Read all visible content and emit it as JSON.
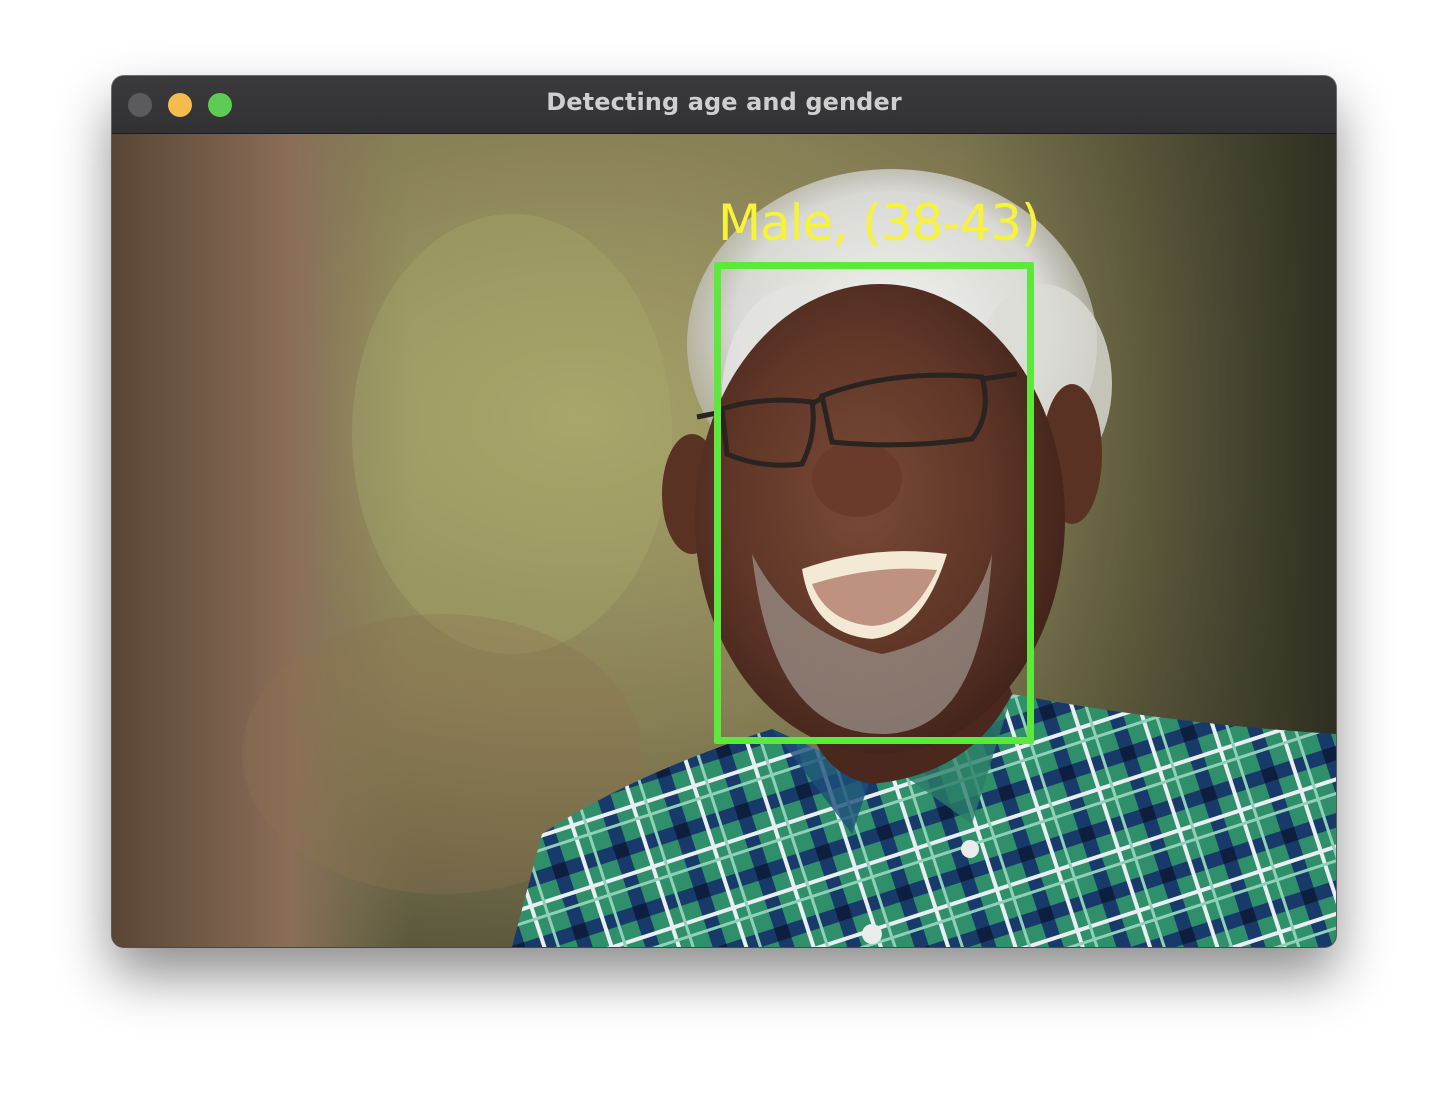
{
  "window": {
    "title": "Detecting age and gender"
  },
  "detection": {
    "label": "Male, (38-43)",
    "box_color": "#5de83c",
    "label_color": "#f7f23a"
  },
  "icons": {
    "close": "close-traffic-light-icon",
    "minimize": "minimize-traffic-light-icon",
    "maximize": "maximize-traffic-light-icon"
  }
}
